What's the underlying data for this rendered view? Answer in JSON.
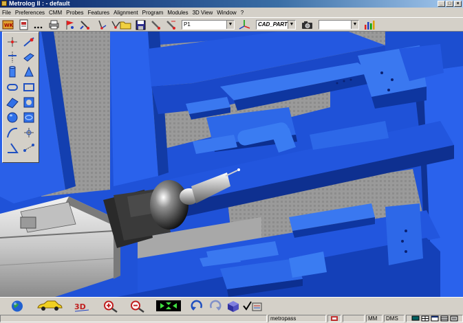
{
  "window": {
    "title": "Metrolog II : - default"
  },
  "menu": [
    "File",
    "Preferences",
    "CMM",
    "Probes",
    "Features",
    "Alignment",
    "Program",
    "Modules",
    "3D View",
    "Window",
    "?"
  ],
  "toolbar": {
    "point_combo": "P1",
    "cad_combo": "CAD_PART",
    "extra_combo": ""
  },
  "status": {
    "message": "metropass",
    "unit": "MM",
    "angle": "DMS"
  },
  "colors": {
    "viewport_blue": "#1f52d8",
    "chrome": "#d4d0c8",
    "title_start": "#0a246a"
  }
}
